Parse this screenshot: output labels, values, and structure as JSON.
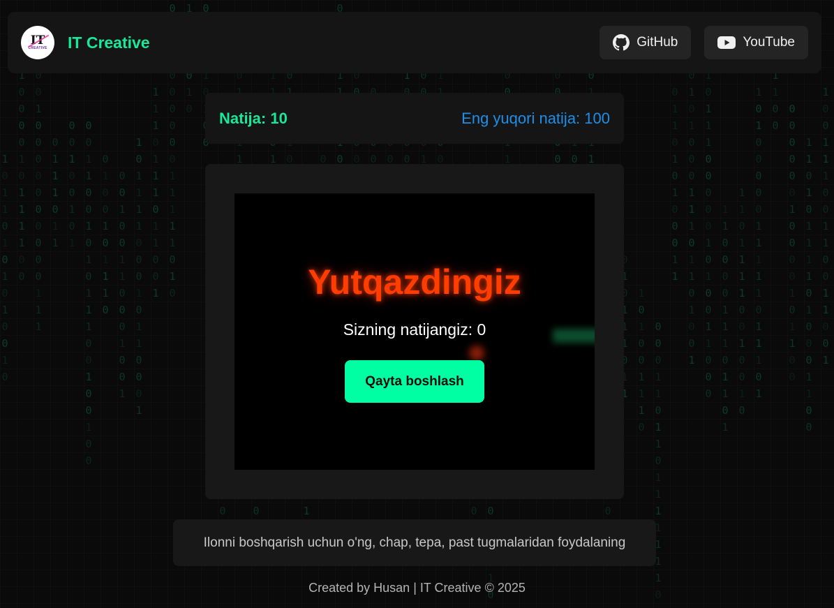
{
  "header": {
    "brand": "IT Creative",
    "logo_text": "IT",
    "logo_subtext": "CREATIVE",
    "links": [
      {
        "label": "GitHub",
        "icon": "github-icon"
      },
      {
        "label": "YouTube",
        "icon": "youtube-icon"
      }
    ]
  },
  "scores": {
    "current": "Natija: 10",
    "high": "Eng yuqori natija: 100"
  },
  "game_over": {
    "title": "Yutqazdingiz",
    "final_score": "Sizning natijangiz: 0",
    "restart_label": "Qayta boshlash"
  },
  "hint": "Ilonni boshqarish uchun o'ng, chap, tepa, past tugmalaridan foydalaning",
  "footer": "Created by Husan | IT Creative © 2025",
  "colors": {
    "accent_green": "#19e89b",
    "high_score_blue": "#1e8fe8",
    "game_over_red": "#ff3d00",
    "restart_button": "#00ffa3"
  }
}
